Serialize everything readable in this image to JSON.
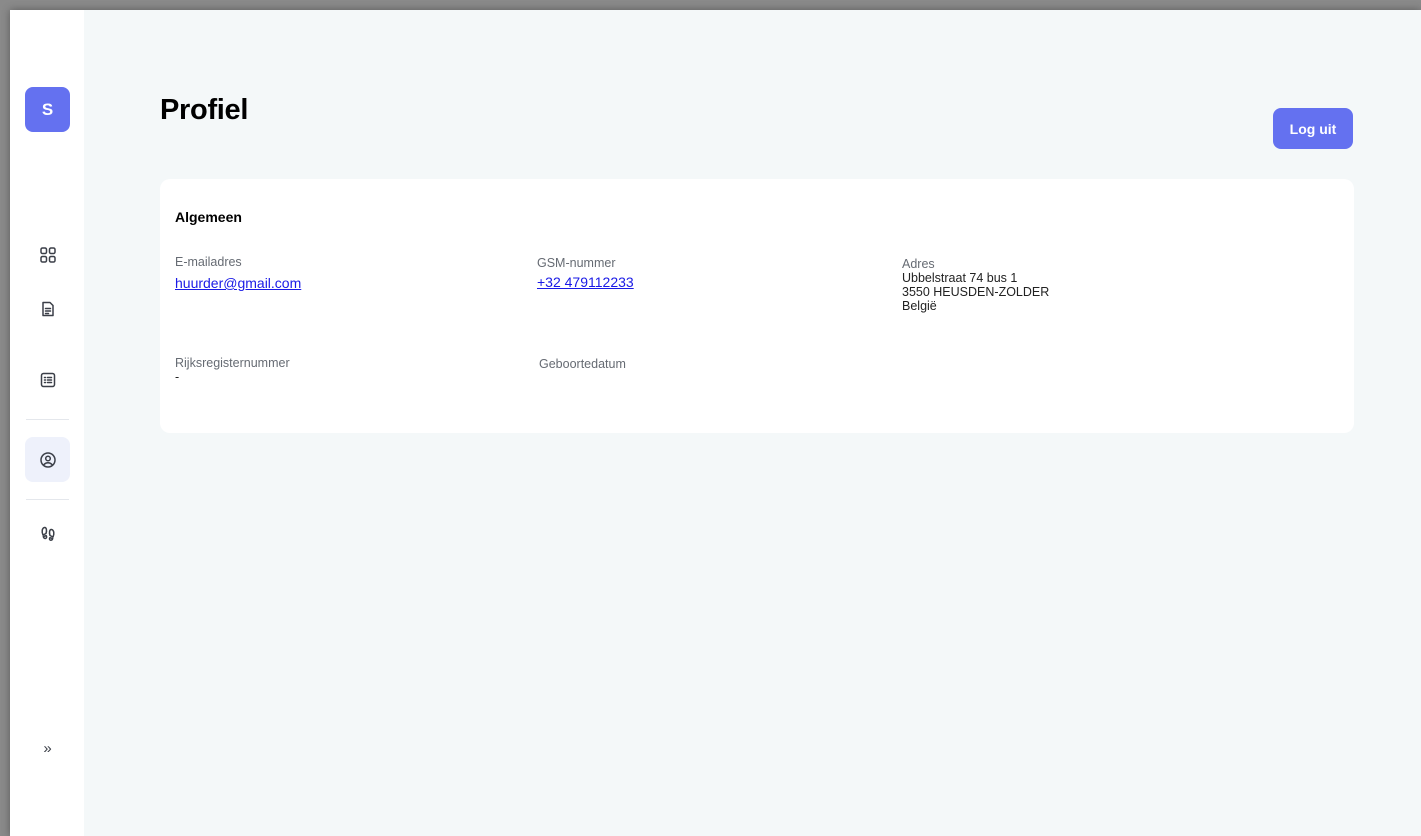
{
  "sidebar": {
    "logo_letter": "S",
    "expand_glyph": "»",
    "items": [
      {
        "icon": "grid-icon",
        "active": false
      },
      {
        "icon": "document-icon",
        "active": false
      },
      {
        "icon": "list-icon",
        "active": false
      },
      {
        "icon": "user-circle-icon",
        "active": true
      },
      {
        "icon": "footprints-icon",
        "active": false
      }
    ]
  },
  "page": {
    "title": "Profiel"
  },
  "header": {
    "logout_label": "Log uit"
  },
  "profile": {
    "section_title": "Algemeen",
    "email": {
      "label": "E-mailadres",
      "value": "huurder@gmail.com"
    },
    "phone": {
      "label": "GSM-nummer",
      "value": "+32 479112233"
    },
    "address": {
      "label": "Adres",
      "street": "Ubbelstraat 74 bus 1",
      "city": "3550 HEUSDEN-ZOLDER",
      "country": "België"
    },
    "national_id": {
      "label": "Rijksregisternummer",
      "value": "-"
    },
    "birthdate": {
      "label": "Geboortedatum",
      "value": ""
    }
  },
  "colors": {
    "accent": "#6471f0",
    "background": "#f4f8f9",
    "link": "#1a1ae6"
  }
}
